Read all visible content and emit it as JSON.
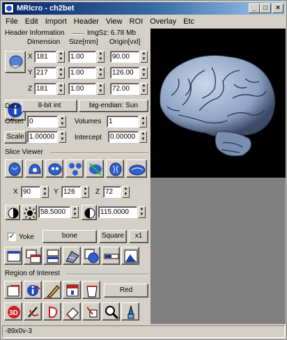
{
  "window": {
    "title": "MRIcro - ch2bet",
    "controls": {
      "minimize": "_",
      "maximize": "□",
      "close": "×"
    }
  },
  "menu": [
    "File",
    "Edit",
    "Import",
    "Header",
    "View",
    "ROI",
    "Overlay",
    "Etc"
  ],
  "header_info": {
    "section_label": "Header Information",
    "img_size": "ImgSz: 6.78 Mb",
    "col_dimension": "Dimension",
    "col_size": "Size[mm]",
    "col_origin": "Origin[vxl]",
    "rows": [
      {
        "axis": "X",
        "dimension": "181",
        "size": "1.00",
        "origin": "90.00"
      },
      {
        "axis": "Y",
        "dimension": "217",
        "size": "1.00",
        "origin": "126.00"
      },
      {
        "axis": "Z",
        "dimension": "181",
        "size": "1.00",
        "origin": "72.00"
      }
    ],
    "data_label": "Data",
    "data_type": "8-bit int",
    "endian": "big-endian: Sun",
    "offset_label": "Offset",
    "offset_value": "0",
    "volumes_label": "Volumes",
    "volumes_value": "1",
    "scale_label": "Scale",
    "scale_value": "1.00000",
    "intercept_label": "Intercept",
    "intercept_value": "0.00000"
  },
  "slice_viewer": {
    "section_label": "Slice Viewer",
    "x_label": "X",
    "x_value": "90",
    "y_label": "Y",
    "y_value": "126",
    "z_label": "Z",
    "z_value": "72",
    "brightness_value": "58.5000",
    "contrast_value": "115.0000",
    "yoke_label": "Yoke",
    "yoke_checked": "✓",
    "lut_label": "bone",
    "shape_label": "Square",
    "zoom_label": "x1"
  },
  "roi": {
    "section_label": "Region of Interest",
    "color_label": "Red"
  },
  "status": "-89x0v-3"
}
